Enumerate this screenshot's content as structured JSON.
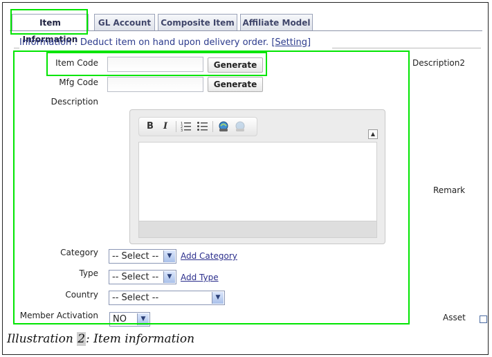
{
  "tabs": [
    {
      "label": "Item Information",
      "active": true
    },
    {
      "label": "GL Account",
      "active": false
    },
    {
      "label": "Composite Item",
      "active": false
    },
    {
      "label": "Affiliate Model",
      "active": false
    }
  ],
  "info": {
    "text": "Information : Deduct item on hand upon delivery order.",
    "setting_link": "[Setting]"
  },
  "form": {
    "item_code": {
      "label": "Item Code",
      "value": "",
      "button": "Generate"
    },
    "mfg_code": {
      "label": "Mfg Code",
      "value": "",
      "button": "Generate"
    },
    "description": {
      "label": "Description"
    },
    "category": {
      "label": "Category",
      "selected": "-- Select --",
      "link": "Add Category"
    },
    "type": {
      "label": "Type",
      "selected": "-- Select --",
      "link": "Add Type"
    },
    "country": {
      "label": "Country",
      "selected": "-- Select --"
    },
    "member_activation": {
      "label": "Member Activation",
      "selected": "NO"
    }
  },
  "right_column": {
    "description2": "Description2",
    "remark": "Remark",
    "asset": "Asset"
  },
  "editor": {
    "tools": [
      "bold-icon",
      "italic-icon",
      "ordered-list-icon",
      "unordered-list-icon",
      "link-icon",
      "unlink-icon"
    ]
  },
  "caption": {
    "prefix": "Illustration",
    "number": "2",
    "suffix": ": Item information"
  },
  "colors": {
    "highlight": "#00e500",
    "link": "#2b2e8c",
    "info_text": "#2b3a8c"
  }
}
